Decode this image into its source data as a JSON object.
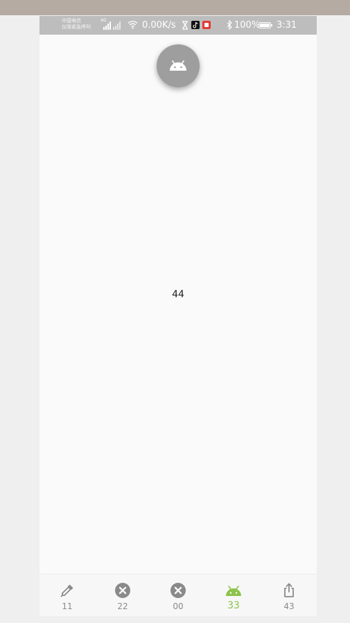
{
  "status_bar": {
    "carrier_line1": "中国电信",
    "carrier_line2": "仅限紧急呼叫",
    "net_badge": "4G",
    "net_speed": "0.00K/s",
    "battery": "100%",
    "time": "3:31"
  },
  "fab": {
    "icon": "android-icon"
  },
  "content": {
    "text": "44"
  },
  "bottom_nav": {
    "active_color": "#8bc34a",
    "inactive_color": "#8a8a8a",
    "items": [
      {
        "label": "11",
        "icon": "eyedropper-icon",
        "active": false
      },
      {
        "label": "22",
        "icon": "cancel-circle-icon",
        "active": false
      },
      {
        "label": "00",
        "icon": "cancel-circle-icon",
        "active": false
      },
      {
        "label": "33",
        "icon": "android-icon",
        "active": true
      },
      {
        "label": "43",
        "icon": "share-icon",
        "active": false
      }
    ]
  }
}
